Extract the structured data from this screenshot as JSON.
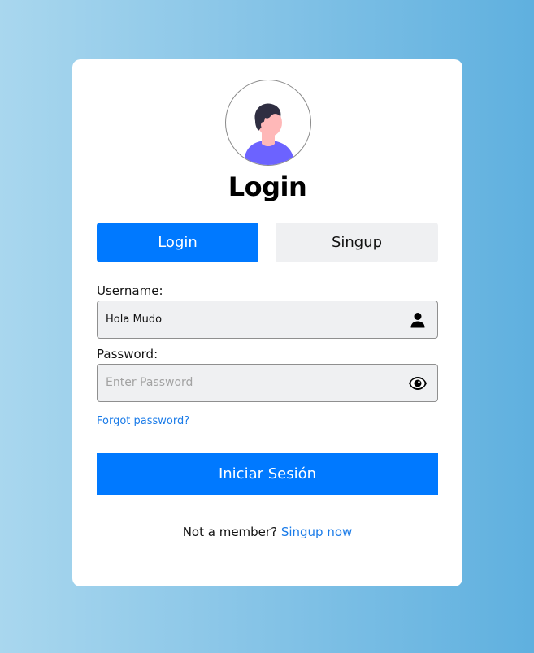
{
  "header": {
    "title": "Login"
  },
  "tabs": {
    "login_label": "Login",
    "signup_label": "Singup"
  },
  "form": {
    "username_label": "Username:",
    "username_value": "Hola Mudo",
    "password_label": "Password:",
    "password_value": "",
    "password_placeholder": "Enter Password",
    "forgot_label": "Forgot password?",
    "submit_label": "Iniciar Sesión"
  },
  "footer": {
    "prompt": "Not a member?",
    "signup_link": "Singup now"
  },
  "icons": {
    "username_field_icon": "user-icon",
    "password_field_icon": "eye-icon",
    "avatar": "user-avatar-illustration"
  },
  "colors": {
    "accent": "#0079ff",
    "link": "#1a7be8",
    "inactive_tab": "#eff0f2",
    "field_bg": "#eff0f2",
    "avatar_shirt": "#6c63ff",
    "avatar_hair": "#2f2e41",
    "avatar_skin": "#ffb8b8"
  }
}
